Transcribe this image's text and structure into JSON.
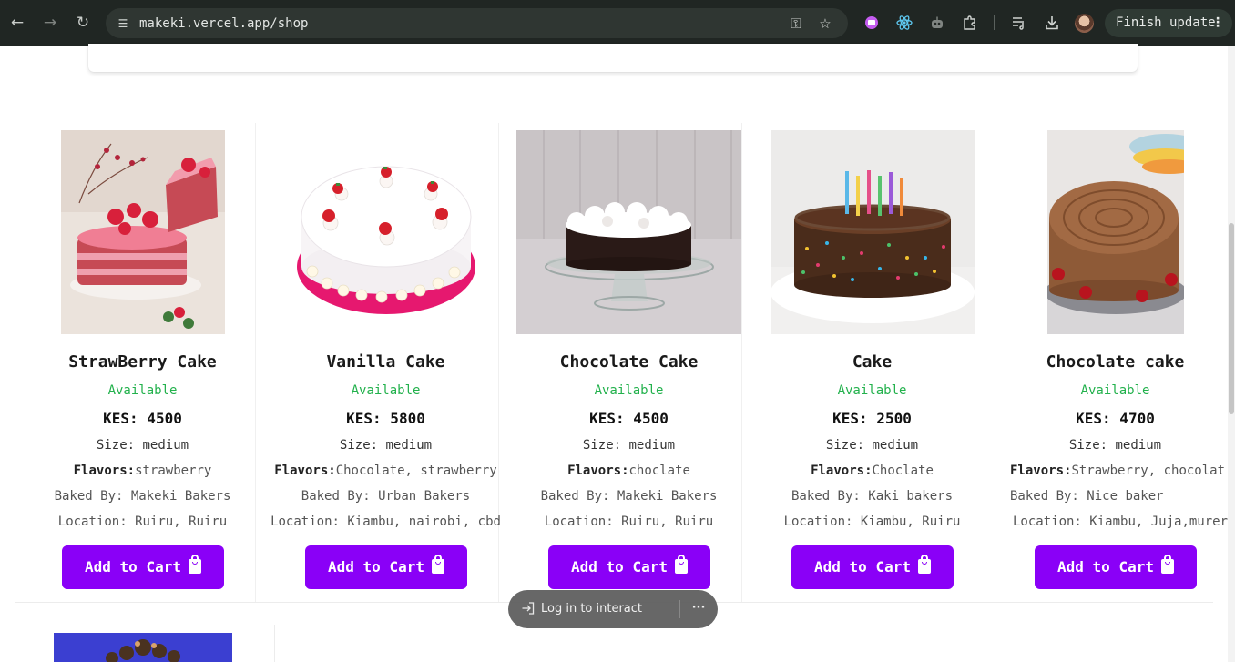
{
  "browser": {
    "url": "makeki.vercel.app/shop",
    "finish_update_label": "Finish update",
    "finish_update_more": "⋮"
  },
  "products": [
    {
      "title": "StrawBerry Cake",
      "availability": "Available",
      "price": "KES: 4500",
      "size_label": "Size:",
      "size": "medium",
      "flavors_label": "Flavors:",
      "flavors": "strawberry",
      "baked_label": "Baked By:",
      "baked_by": "Makeki Bakers",
      "location_label": "Location:",
      "location": "Ruiru, Ruiru",
      "button_label": "Add to Cart"
    },
    {
      "title": "Vanilla Cake",
      "availability": "Available",
      "price": "KES: 5800",
      "size_label": "Size:",
      "size": "medium",
      "flavors_label": "Flavors:",
      "flavors": "Chocolate, strawberry",
      "baked_label": "Baked By:",
      "baked_by": "Urban Bakers",
      "location_label": "Location:",
      "location": "Kiambu, nairobi, cbd",
      "button_label": "Add to Cart"
    },
    {
      "title": "Chocolate Cake",
      "availability": "Available",
      "price": "KES: 4500",
      "size_label": "Size:",
      "size": "medium",
      "flavors_label": "Flavors:",
      "flavors": "choclate",
      "baked_label": "Baked By:",
      "baked_by": "Makeki Bakers",
      "location_label": "Location:",
      "location": "Ruiru, Ruiru",
      "button_label": "Add to Cart"
    },
    {
      "title": "Cake",
      "availability": "Available",
      "price": "KES: 2500",
      "size_label": "Size:",
      "size": "medium",
      "flavors_label": "Flavors:",
      "flavors": "Choclate",
      "baked_label": "Baked By:",
      "baked_by": "Kaki bakers",
      "location_label": "Location:",
      "location": "Kiambu, Ruiru",
      "button_label": "Add to Cart"
    },
    {
      "title": "Chocolate cake",
      "availability": "Available",
      "price": "KES: 4700",
      "size_label": "Size:",
      "size": "medium",
      "flavors_label": "Flavors:",
      "flavors": "Strawberry, chocolat",
      "baked_label": "Baked By:",
      "baked_by": "Nice baker",
      "location_label": "Location:",
      "location": "Kiambu, Juja,murer",
      "button_label": "Add to Cart"
    }
  ],
  "interact_pill": {
    "label": "Log in to interact",
    "more": "···"
  },
  "colors": {
    "accent": "#8a00f7",
    "available": "#22b14c"
  },
  "icons": {
    "back": "arrow-left-icon",
    "forward": "arrow-right-icon",
    "reload": "reload-icon",
    "site_info": "tune-icon",
    "password": "key-icon",
    "bookmark": "star-icon",
    "cart": "shopping-bag-icon",
    "login": "login-icon"
  }
}
